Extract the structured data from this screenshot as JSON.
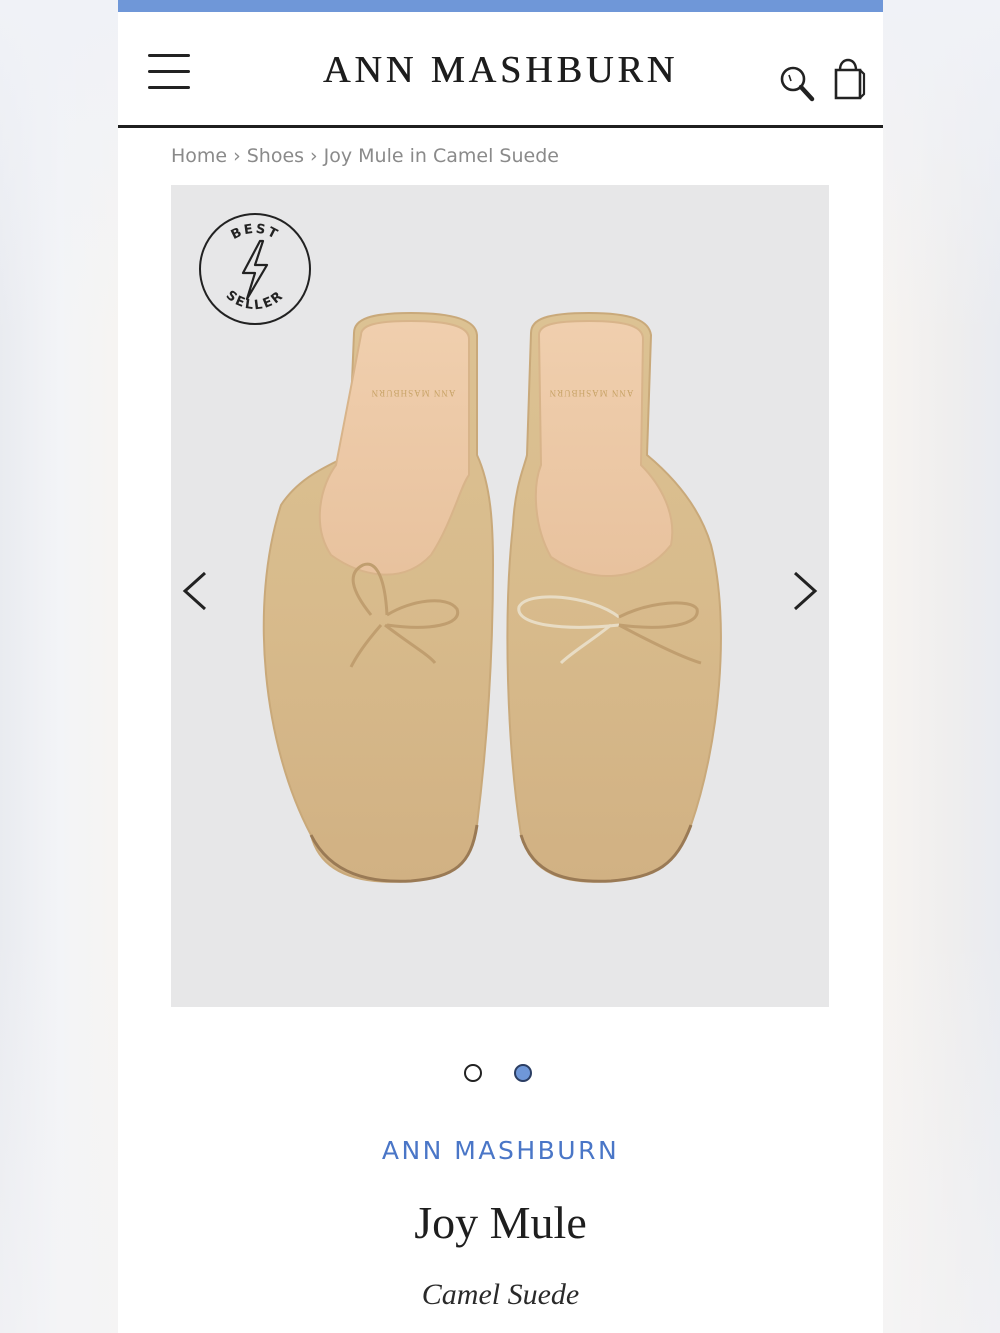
{
  "header": {
    "logo": "ANN MASHBURN",
    "menu_icon": "hamburger-menu-icon",
    "search_icon": "search-icon",
    "cart_icon": "shopping-bag-icon",
    "accent_color": "#6f97d8"
  },
  "breadcrumb": {
    "items": [
      "Home",
      "Shoes",
      "Joy Mule in Camel Suede"
    ],
    "separator": "›"
  },
  "gallery": {
    "badge_top": "BEST",
    "badge_bottom": "SELLER",
    "badge_icon": "lightning-bolt-icon",
    "insole_text": "ANN MASHBURN",
    "prev_icon": "chevron-left-icon",
    "next_icon": "chevron-right-icon",
    "slide_count": 2,
    "active_slide": 2
  },
  "product": {
    "brand": "ANN MASHBURN",
    "title": "Joy Mule",
    "variant": "Camel Suede"
  }
}
